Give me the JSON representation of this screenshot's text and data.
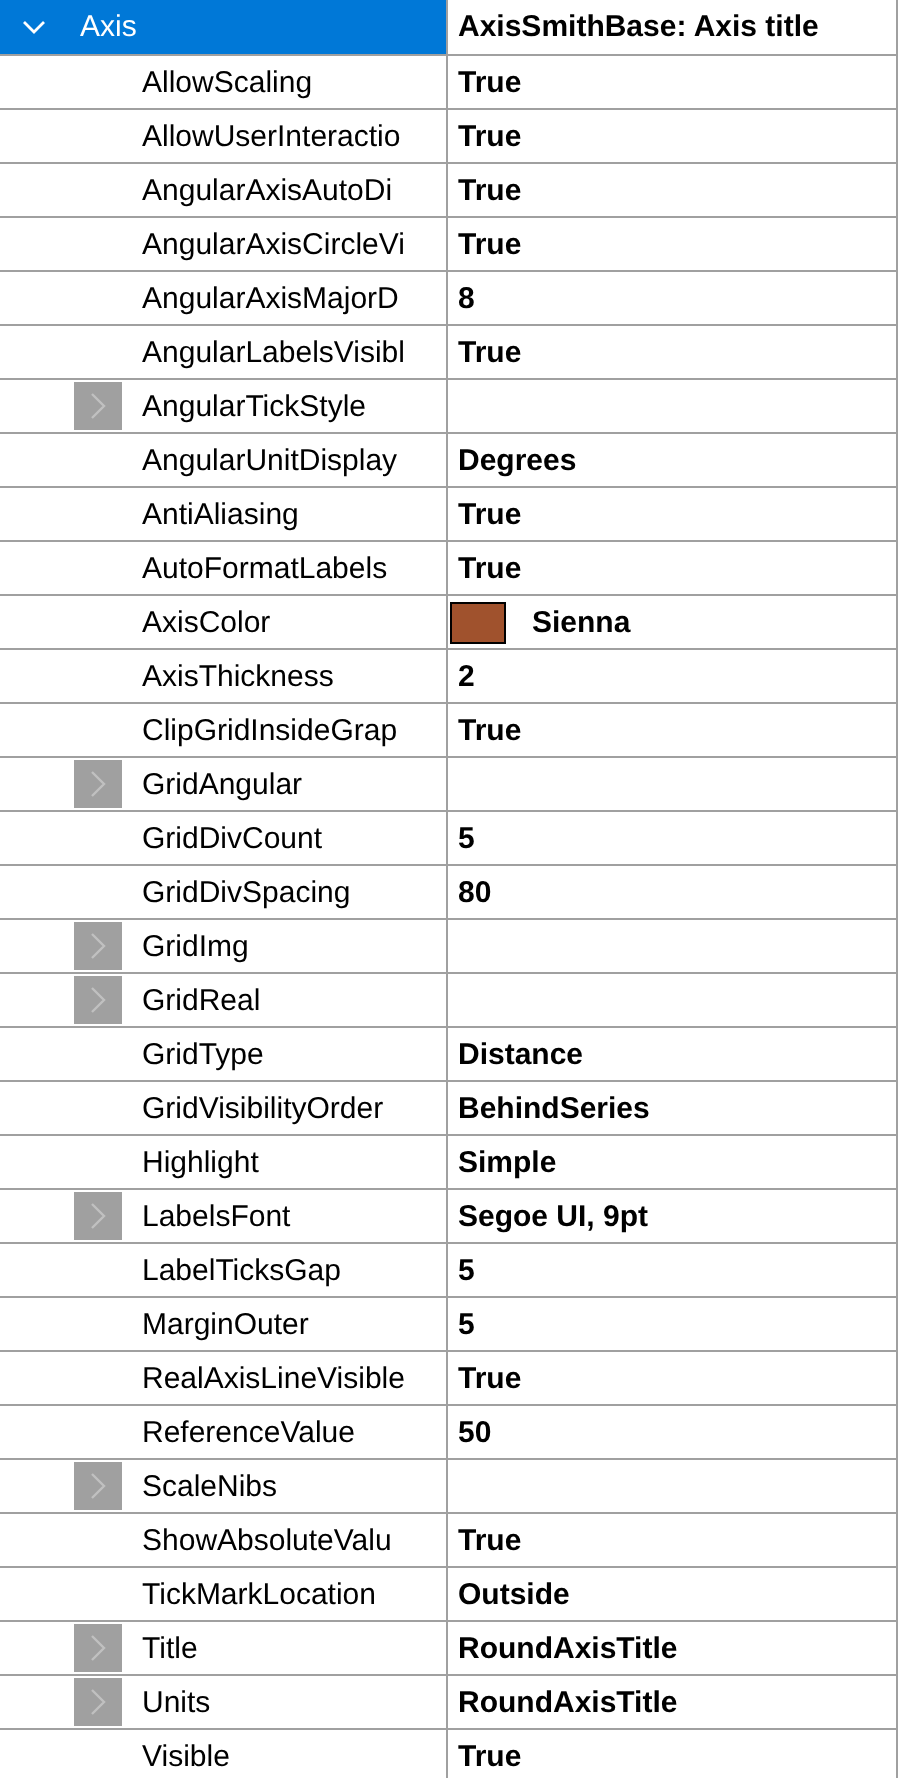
{
  "category": {
    "label": "Axis",
    "value": "AxisSmithBase: Axis title",
    "expanded": true,
    "selected": true
  },
  "properties": [
    {
      "name": "AllowScaling",
      "value": "True",
      "kind": "plain"
    },
    {
      "name": "AllowUserInteractio",
      "value": "True",
      "kind": "plain"
    },
    {
      "name": "AngularAxisAutoDi",
      "value": "True",
      "kind": "plain"
    },
    {
      "name": "AngularAxisCircleVi",
      "value": "True",
      "kind": "plain"
    },
    {
      "name": "AngularAxisMajorD",
      "value": "8",
      "kind": "plain"
    },
    {
      "name": "AngularLabelsVisibl",
      "value": "True",
      "kind": "plain"
    },
    {
      "name": "AngularTickStyle",
      "kind": "expandable",
      "expanded": false
    },
    {
      "name": "AngularUnitDisplay",
      "value": "Degrees",
      "kind": "plain"
    },
    {
      "name": "AntiAliasing",
      "value": "True",
      "kind": "plain"
    },
    {
      "name": "AutoFormatLabels",
      "value": "True",
      "kind": "plain"
    },
    {
      "name": "AxisColor",
      "value": "Sienna",
      "kind": "color",
      "color": "#a0522d"
    },
    {
      "name": "AxisThickness",
      "value": "2",
      "kind": "plain"
    },
    {
      "name": "ClipGridInsideGrap",
      "value": "True",
      "kind": "plain"
    },
    {
      "name": "GridAngular",
      "kind": "expandable",
      "expanded": false
    },
    {
      "name": "GridDivCount",
      "value": "5",
      "kind": "plain"
    },
    {
      "name": "GridDivSpacing",
      "value": "80",
      "kind": "plain"
    },
    {
      "name": "GridImg",
      "kind": "expandable",
      "expanded": false
    },
    {
      "name": "GridReal",
      "kind": "expandable",
      "expanded": false
    },
    {
      "name": "GridType",
      "value": "Distance",
      "kind": "plain"
    },
    {
      "name": "GridVisibilityOrder",
      "value": "BehindSeries",
      "kind": "plain"
    },
    {
      "name": "Highlight",
      "value": "Simple",
      "kind": "plain"
    },
    {
      "name": "LabelsFont",
      "value": "Segoe UI, 9pt",
      "kind": "expandable",
      "expanded": false
    },
    {
      "name": "LabelTicksGap",
      "value": "5",
      "kind": "plain"
    },
    {
      "name": "MarginOuter",
      "value": "5",
      "kind": "plain"
    },
    {
      "name": "RealAxisLineVisible",
      "value": "True",
      "kind": "plain"
    },
    {
      "name": "ReferenceValue",
      "value": "50",
      "kind": "plain"
    },
    {
      "name": "ScaleNibs",
      "kind": "expandable",
      "expanded": false
    },
    {
      "name": "ShowAbsoluteValu",
      "value": "True",
      "kind": "plain"
    },
    {
      "name": "TickMarkLocation",
      "value": "Outside",
      "kind": "plain"
    },
    {
      "name": "Title",
      "value": "RoundAxisTitle",
      "kind": "expandable",
      "expanded": false
    },
    {
      "name": "Units",
      "value": "RoundAxisTitle",
      "kind": "expandable",
      "expanded": false
    },
    {
      "name": "Visible",
      "value": "True",
      "kind": "plain"
    }
  ]
}
